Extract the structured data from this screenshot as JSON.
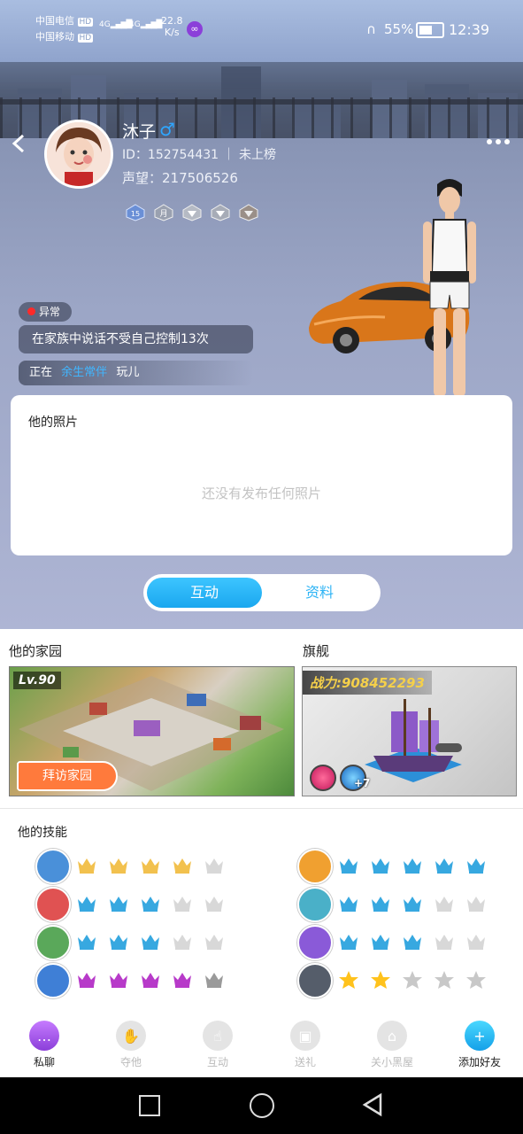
{
  "status_bar": {
    "carrier1": "中国电信",
    "carrier2": "中国移动",
    "hd": "HD",
    "net1": "4G",
    "net2": "4G",
    "speed_value": "22.8",
    "speed_unit": "K/s",
    "battery": "55%",
    "time": "12:39"
  },
  "profile": {
    "name": "沐子",
    "gender_symbol": "♂",
    "id_line": "ID：152754431 ｜ 未上榜",
    "fame": "声望：217506526",
    "medal_labels": [
      "15",
      "月"
    ]
  },
  "anomaly": {
    "tag": "异常",
    "message": "在家族中说话不受自己控制13次",
    "playing_prefix": "正在",
    "playing_game": "余生常伴",
    "playing_suffix": "玩儿"
  },
  "photos": {
    "title": "他的照片",
    "empty_text": "还没有发布任何照片"
  },
  "tabs": {
    "active": "互动",
    "inactive": "资料"
  },
  "home": {
    "title": "他的家园",
    "level": "Lv.90",
    "visit_button": "拜访家园"
  },
  "flagship": {
    "title": "旗舰",
    "power": "战力:908452293",
    "bonus": "+7"
  },
  "skills": {
    "title": "他的技能",
    "left": [
      {
        "crowns": [
          "gold",
          "gold",
          "gold",
          "gold",
          "grey"
        ]
      },
      {
        "crowns": [
          "blue",
          "blue",
          "blue",
          "grey",
          "grey"
        ]
      },
      {
        "crowns": [
          "blue",
          "blue",
          "blue",
          "grey",
          "grey"
        ]
      },
      {
        "crowns": [
          "purple",
          "purple",
          "purple",
          "purple",
          "silver"
        ]
      }
    ],
    "right": [
      {
        "crowns": [
          "blue",
          "blue",
          "blue",
          "blue",
          "blue"
        ]
      },
      {
        "crowns": [
          "blue",
          "blue",
          "blue",
          "grey",
          "grey"
        ]
      },
      {
        "crowns": [
          "blue",
          "blue",
          "blue",
          "grey",
          "grey"
        ]
      },
      {
        "crowns": [
          "star-gold",
          "star-gold",
          "star-grey",
          "star-grey",
          "star-grey"
        ]
      }
    ]
  },
  "bottom_nav": [
    {
      "label": "私聊",
      "icon": "chat-icon",
      "active": true
    },
    {
      "label": "夺他",
      "icon": "grab-icon",
      "active": false
    },
    {
      "label": "互动",
      "icon": "hand-icon",
      "active": false
    },
    {
      "label": "送礼",
      "icon": "gift-icon",
      "active": false
    },
    {
      "label": "关小黑屋",
      "icon": "lock-icon",
      "active": false
    },
    {
      "label": "添加好友",
      "icon": "add-friend-icon",
      "active": true
    }
  ],
  "colors": {
    "accent_blue": "#1aa7ef",
    "link_blue": "#41b6ff",
    "orange_button": "#ff7a3c",
    "alert_red": "#ff2a2a"
  }
}
